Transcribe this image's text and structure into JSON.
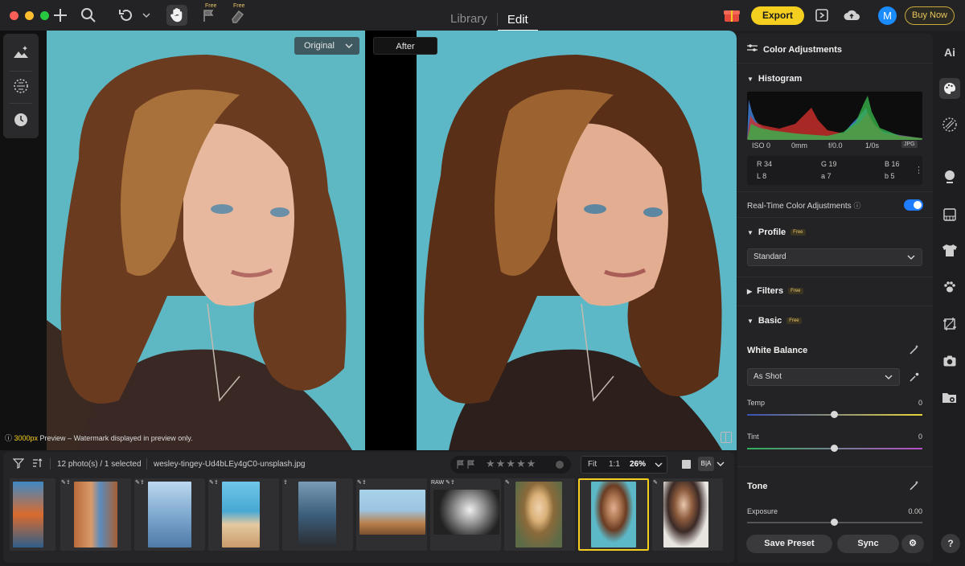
{
  "titlebar": {
    "nav": {
      "library_label": "Library",
      "edit_label": "Edit"
    },
    "free_tag_1": "Free",
    "free_tag_2": "Free",
    "export_label": "Export",
    "avatar_initial": "M",
    "buy_now_label": "Buy Now"
  },
  "canvas": {
    "original_label": "Original",
    "after_label": "After",
    "preview_note_highlight": "3000px",
    "preview_note_rest": " Preview – Watermark displayed in preview only."
  },
  "filmstrip": {
    "photo_count": "12 photo(s) / 1 selected",
    "filename": "wesley-tingey-Ud4bLEy4gC0-unsplash.jpg",
    "fit_label": "Fit",
    "one_to_one_label": "1:1",
    "zoom_value": "26%",
    "ba_label": "B|A",
    "raw_badge": "RAW",
    "thumbnails": [
      {
        "colors": [
          "#d96b2e",
          "#3f89c5"
        ]
      },
      {
        "colors": [
          "#c77a4a",
          "#5a8bbd"
        ]
      },
      {
        "colors": [
          "#9bbfe0",
          "#4f79a8"
        ]
      },
      {
        "colors": [
          "#8fd2e8",
          "#e4c9a0"
        ]
      },
      {
        "colors": [
          "#3c5f7c",
          "#2a2b2f"
        ]
      },
      {
        "colors": [
          "#9cc5e2",
          "#b97f4b"
        ]
      },
      {
        "colors": [
          "#222222",
          "#9a9a9a"
        ]
      },
      {
        "colors": [
          "#5e6b47",
          "#d9b077"
        ]
      },
      {
        "colors": [
          "#5cb8c7",
          "#6b3c23"
        ]
      },
      {
        "colors": [
          "#e8e5e0",
          "#3b2a26"
        ]
      }
    ]
  },
  "right_panel": {
    "title": "Color Adjustments",
    "histogram_title": "Histogram",
    "exif": {
      "iso": "ISO 0",
      "focal": "0mm",
      "aperture": "f/0.0",
      "shutter": "1/0s",
      "format": "JPG"
    },
    "readout": {
      "r": "R 34",
      "g": "G 19",
      "b": "B 16",
      "l": "L 8",
      "a": "a 7",
      "bb": "b 5"
    },
    "realtime_label": "Real-Time Color Adjustments",
    "profile": {
      "title": "Profile",
      "free": "Free",
      "value": "Standard"
    },
    "filters": {
      "title": "Filters",
      "free": "Free"
    },
    "basic": {
      "title": "Basic",
      "free": "Free"
    },
    "white_balance": {
      "title": "White Balance",
      "value": "As Shot"
    },
    "temp": {
      "label": "Temp",
      "value": "0"
    },
    "tint": {
      "label": "Tint",
      "value": "0"
    },
    "tone": {
      "title": "Tone"
    },
    "exposure": {
      "label": "Exposure",
      "value": "0.00"
    },
    "save_preset_label": "Save Preset",
    "sync_label": "Sync"
  },
  "right_column": {
    "ai_label": "Ai",
    "help_label": "?"
  },
  "colors": {
    "accent_yellow": "#f5cf1f",
    "toggle_blue": "#1f7cff",
    "backdrop_teal": "#5cb8c7"
  }
}
